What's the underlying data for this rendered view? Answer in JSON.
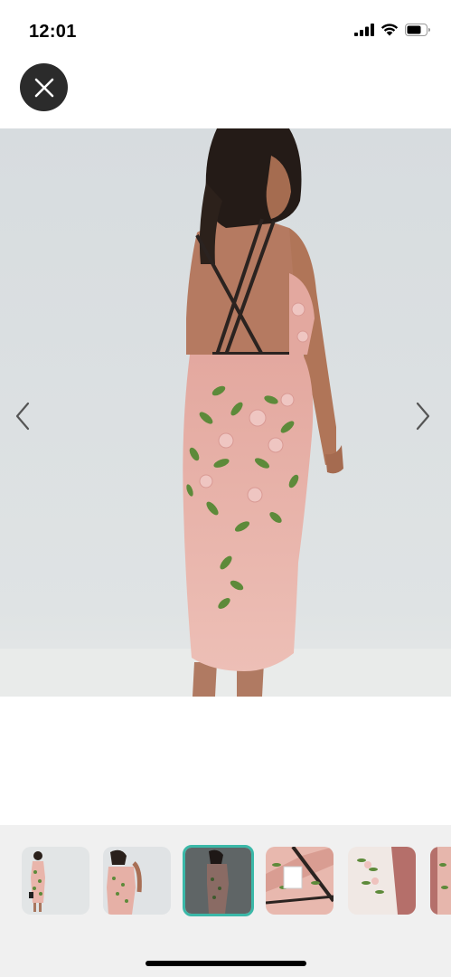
{
  "status_bar": {
    "time": "12:01",
    "signal_icon": "cellular-signal-icon",
    "wifi_icon": "wifi-icon",
    "battery_icon": "battery-icon"
  },
  "viewer": {
    "close_icon": "close-icon",
    "prev_icon": "chevron-left-icon",
    "next_icon": "chevron-right-icon",
    "main_image": "product-photo-dress-back-view",
    "thumbnails": [
      {
        "name": "thumb-1",
        "selected": false
      },
      {
        "name": "thumb-2",
        "selected": false
      },
      {
        "name": "thumb-3",
        "selected": true
      },
      {
        "name": "thumb-4",
        "selected": false
      },
      {
        "name": "thumb-5",
        "selected": false
      },
      {
        "name": "thumb-6",
        "selected": false
      }
    ]
  },
  "colors": {
    "selected_border": "#3bb8a8",
    "dress_pink": "#e8b4ac",
    "leaf_green": "#5d8a3a",
    "background_grey": "#dde1e3"
  }
}
